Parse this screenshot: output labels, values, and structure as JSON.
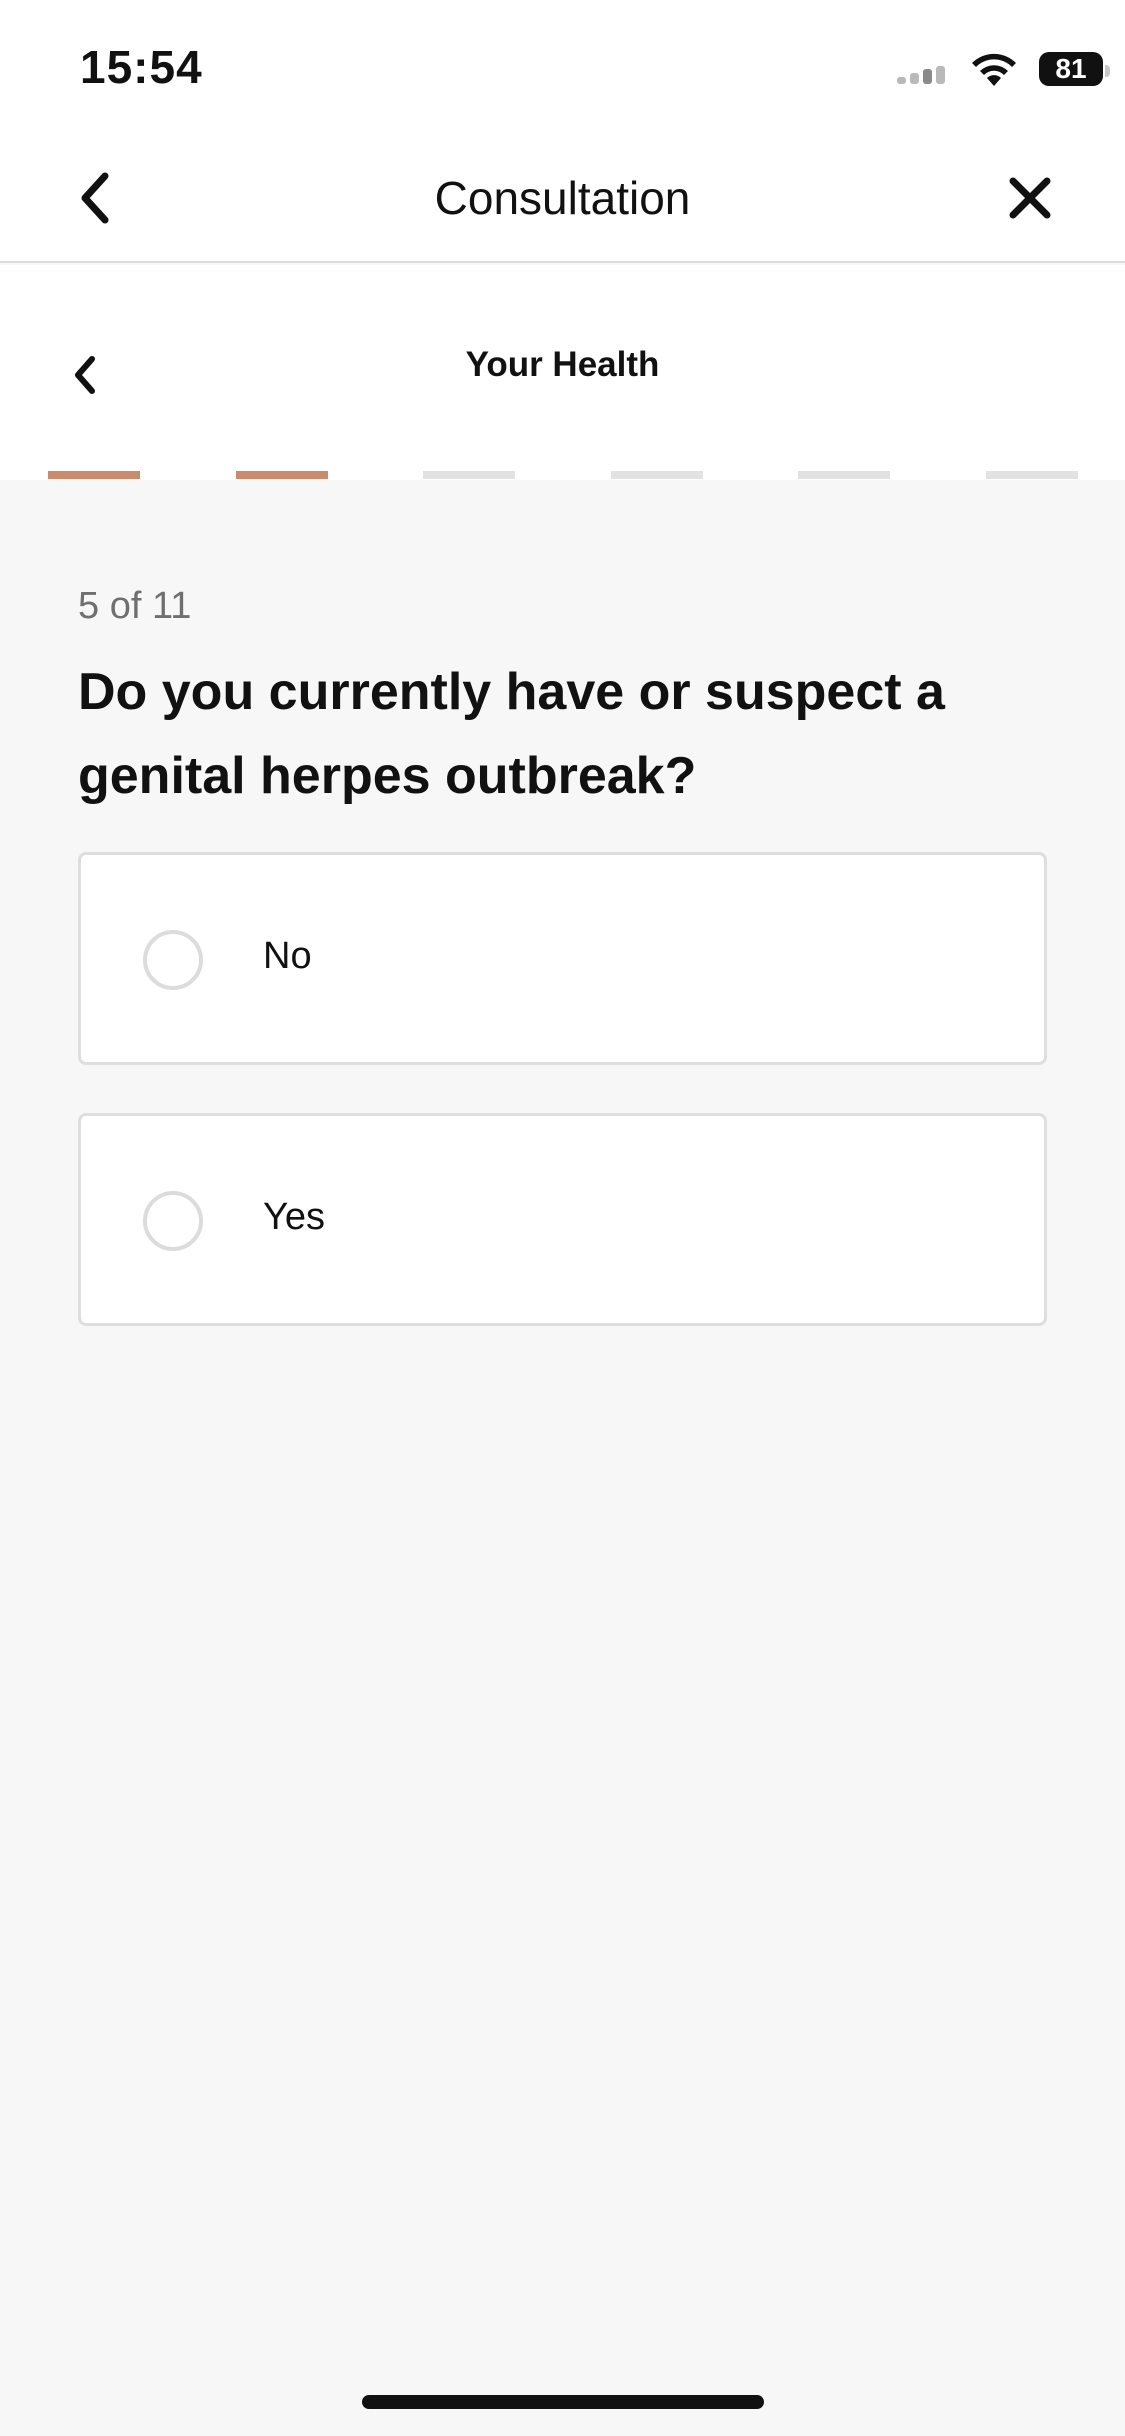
{
  "status_bar": {
    "time": "15:54",
    "battery": "81",
    "icons": [
      "signal-icon",
      "wifi-icon",
      "battery-icon"
    ]
  },
  "nav": {
    "title": "Consultation",
    "back_icon": "chevron-left-icon",
    "close_icon": "close-icon"
  },
  "section": {
    "title": "Your Health",
    "back_icon": "chevron-left-icon",
    "progress_total_segments": 6,
    "progress_completed_segments": 2,
    "accent_color": "#c98b6b"
  },
  "question": {
    "counter": "5 of 11",
    "text": "Do you currently have or suspect a genital herpes outbreak?",
    "options": [
      {
        "label": "No",
        "selected": false
      },
      {
        "label": "Yes",
        "selected": false
      }
    ]
  }
}
